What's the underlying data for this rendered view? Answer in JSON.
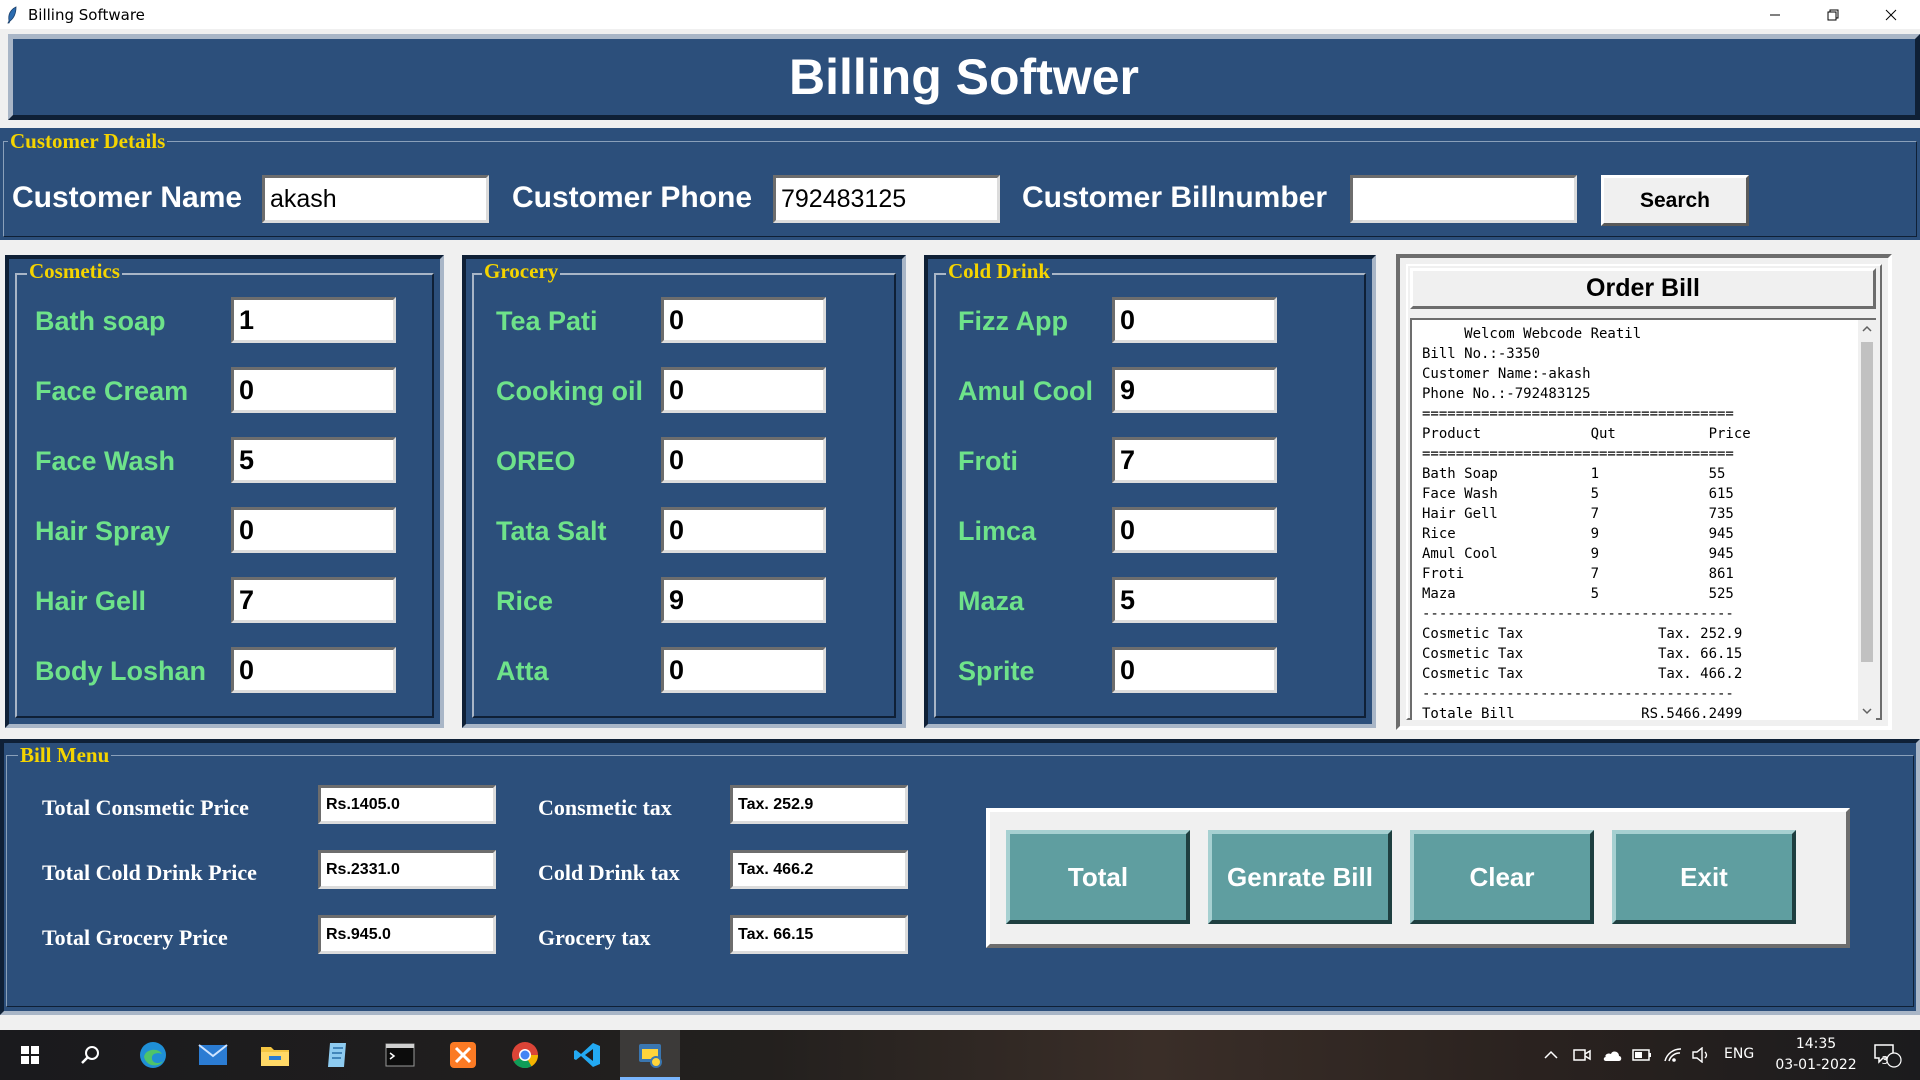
{
  "window": {
    "title": "Billing Software"
  },
  "header": {
    "title": "Billing Softwer"
  },
  "customer": {
    "legend": "Customer Details",
    "name_label": "Customer Name",
    "name_value": "akash",
    "phone_label": "Customer Phone",
    "phone_value": "792483125",
    "billnumber_label": "Customer Billnumber",
    "billnumber_value": "",
    "search_label": "Search"
  },
  "cosmetics": {
    "legend": "Cosmetics",
    "items": [
      {
        "label": "Bath soap",
        "qty": "1"
      },
      {
        "label": "Face Cream",
        "qty": "0"
      },
      {
        "label": "Face Wash",
        "qty": "5"
      },
      {
        "label": "Hair Spray",
        "qty": "0"
      },
      {
        "label": "Hair Gell",
        "qty": "7"
      },
      {
        "label": "Body Loshan",
        "qty": "0"
      }
    ]
  },
  "grocery": {
    "legend": "Grocery",
    "items": [
      {
        "label": "Tea Pati",
        "qty": "0"
      },
      {
        "label": "Cooking oil",
        "qty": "0"
      },
      {
        "label": "OREO",
        "qty": "0"
      },
      {
        "label": "Tata Salt",
        "qty": "0"
      },
      {
        "label": "Rice",
        "qty": "9"
      },
      {
        "label": "Atta",
        "qty": "0"
      }
    ]
  },
  "colddrink": {
    "legend": "Cold Drink",
    "items": [
      {
        "label": "Fizz App",
        "qty": "0"
      },
      {
        "label": "Amul Cool",
        "qty": "9"
      },
      {
        "label": "Froti",
        "qty": "7"
      },
      {
        "label": "Limca",
        "qty": "0"
      },
      {
        "label": "Maza",
        "qty": "5"
      },
      {
        "label": "Sprite",
        "qty": "0"
      }
    ]
  },
  "order_bill": {
    "title": "Order Bill",
    "text": "     Welcom Webcode Reatil\nBill No.:-3350\nCustomer Name:-akash\nPhone No.:-792483125\n=====================================\nProduct             Qut           Price\n=====================================\nBath Soap           1             55\nFace Wash           5             615\nHair Gell           7             735\nRice                9             945\nAmul Cool           9             945\nFroti               7             861\nMaza                5             525\n-------------------------------------\nCosmetic Tax                Tax. 252.9\nCosmetic Tax                Tax. 66.15\nCosmetic Tax                Tax. 466.2\n-------------------------------------\nTotale Bill               RS.5466.2499"
  },
  "bill_menu": {
    "legend": "Bill Menu",
    "cosmetic_price_label": "Total Consmetic Price",
    "cosmetic_price_value": "Rs.1405.0",
    "colddrink_price_label": "Total Cold Drink Price",
    "colddrink_price_value": "Rs.2331.0",
    "grocery_price_label": "Total Grocery Price",
    "grocery_price_value": "Rs.945.0",
    "cosmetic_tax_label": "Consmetic tax",
    "cosmetic_tax_value": "Tax. 252.9",
    "colddrink_tax_label": "Cold Drink tax",
    "colddrink_tax_value": "Tax. 466.2",
    "grocery_tax_label": "Grocery tax",
    "grocery_tax_value": "Tax. 66.15"
  },
  "actions": {
    "total": "Total",
    "generate": "Genrate Bill",
    "clear": "Clear",
    "exit": "Exit"
  },
  "taskbar": {
    "apps": [
      "start-icon",
      "search-icon",
      "edge-icon",
      "mail-icon",
      "file-explorer-icon",
      "notepad-icon",
      "terminal-icon",
      "xampp-icon",
      "chrome-icon",
      "vscode-icon",
      "python-icon"
    ],
    "language": "ENG",
    "time": "14:35",
    "date": "03-01-2022",
    "notifications": "3"
  },
  "colors": {
    "panel": "#2c4f7b",
    "legend": "#f5d400",
    "item_label": "#6ee28a",
    "button": "#5f9ea0"
  }
}
